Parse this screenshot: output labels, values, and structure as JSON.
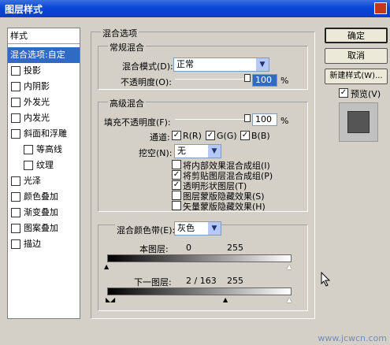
{
  "window": {
    "title": "图层样式"
  },
  "sidebar": {
    "header": "样式",
    "items": [
      {
        "label": "混合选项:自定",
        "selected": true,
        "checkbox": false
      },
      {
        "label": "投影",
        "checkbox": true,
        "checked": false
      },
      {
        "label": "内阴影",
        "checkbox": true,
        "checked": false
      },
      {
        "label": "外发光",
        "checkbox": true,
        "checked": false
      },
      {
        "label": "内发光",
        "checkbox": true,
        "checked": false
      },
      {
        "label": "斜面和浮雕",
        "checkbox": true,
        "checked": false
      },
      {
        "label": "等高线",
        "checkbox": true,
        "checked": false
      },
      {
        "label": "纹理",
        "checkbox": true,
        "checked": false
      },
      {
        "label": "光泽",
        "checkbox": true,
        "checked": false
      },
      {
        "label": "颜色叠加",
        "checkbox": true,
        "checked": false
      },
      {
        "label": "渐变叠加",
        "checkbox": true,
        "checked": false
      },
      {
        "label": "图案叠加",
        "checkbox": true,
        "checked": false
      },
      {
        "label": "描边",
        "checkbox": true,
        "checked": false
      }
    ]
  },
  "blending": {
    "group_title": "混合选项",
    "general": {
      "title": "常规混合",
      "mode_label": "混合模式(D):",
      "mode_value": "正常",
      "opacity_label": "不透明度(O):",
      "opacity_value": "100",
      "unit": "%"
    },
    "advanced": {
      "title": "高级混合",
      "fill_label": "填充不透明度(F):",
      "fill_value": "100",
      "unit": "%",
      "channels_label": "通道:",
      "channel_r": "R(R)",
      "channel_g": "G(G)",
      "channel_b": "B(B)",
      "knockout_label": "挖空(N):",
      "knockout_value": "无",
      "options": [
        {
          "label": "将内部效果混合成组(I)",
          "checked": false
        },
        {
          "label": "将剪贴图层混合成组(P)",
          "checked": true
        },
        {
          "label": "透明形状图层(T)",
          "checked": true
        },
        {
          "label": "图层蒙版隐藏效果(S)",
          "checked": false
        },
        {
          "label": "矢量蒙版隐藏效果(H)",
          "checked": false
        }
      ]
    },
    "blend_if": {
      "label": "混合颜色带(E):",
      "value": "灰色",
      "this_layer_label": "本图层:",
      "this_layer_low": "0",
      "this_layer_high": "255",
      "under_layer_label": "下一图层:",
      "under_layer_value": "2 / 163",
      "under_layer_high": "255"
    }
  },
  "buttons": {
    "ok": "确定",
    "cancel": "取消",
    "new_style": "新建样式(W)..."
  },
  "preview": {
    "label": "预览(V)",
    "checked": true
  },
  "watermark": "www.jcwcn.com"
}
